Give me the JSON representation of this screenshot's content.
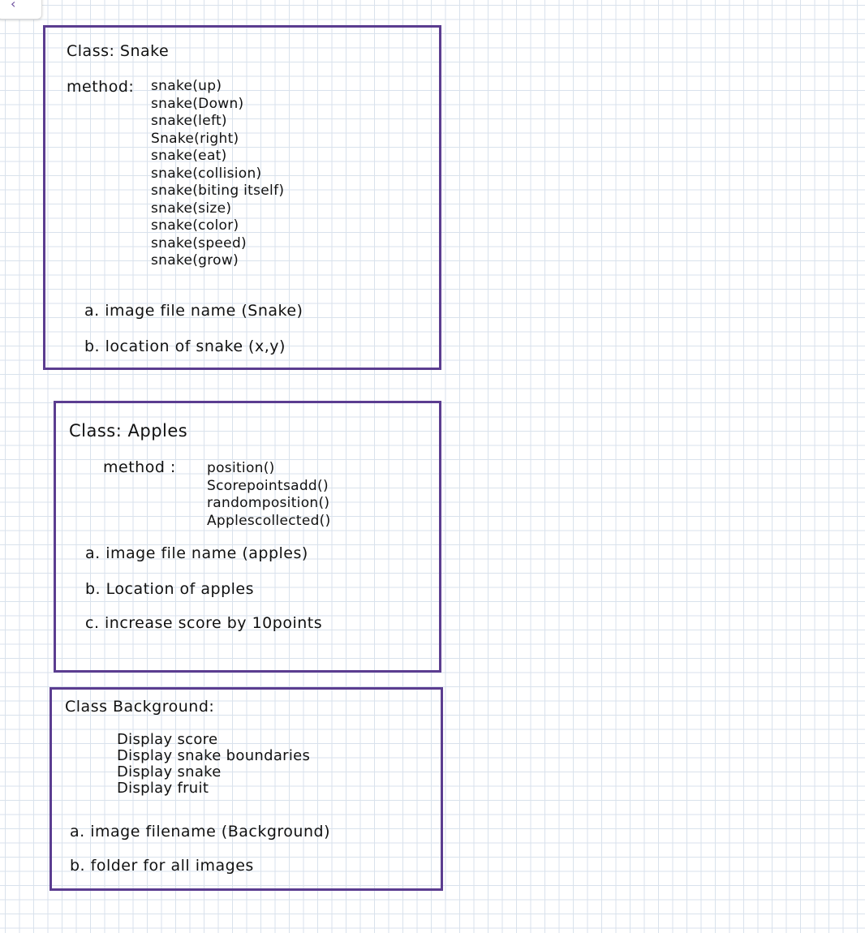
{
  "back_icon": "chevron-left-icon",
  "border_color": "#5b3d90",
  "classes": [
    {
      "title": "Class: Snake",
      "method_label": "method:",
      "methods": [
        "snake(up)",
        "snake(Down)",
        "snake(left)",
        "Snake(right)",
        "snake(eat)",
        "snake(collision)",
        "snake(biting itself)",
        "snake(size)",
        "snake(color)",
        "snake(speed)",
        "snake(grow)"
      ],
      "items": [
        "a. image file name (Snake)",
        "b. location of snake (x,y)"
      ]
    },
    {
      "title": "Class: Apples",
      "method_label": "method :",
      "methods": [
        "position()",
        "Scorepointsadd()",
        "randomposition()",
        "Applescollected()"
      ],
      "items": [
        "a. image file name (apples)",
        "b. Location of apples",
        "c. increase score by 10points"
      ]
    },
    {
      "title": "Class Background:",
      "methods": [
        "Display score",
        "Display snake boundaries",
        "Display snake",
        "Display fruit"
      ],
      "items": [
        "a. image filename (Background)",
        "b. folder for all images"
      ]
    }
  ]
}
